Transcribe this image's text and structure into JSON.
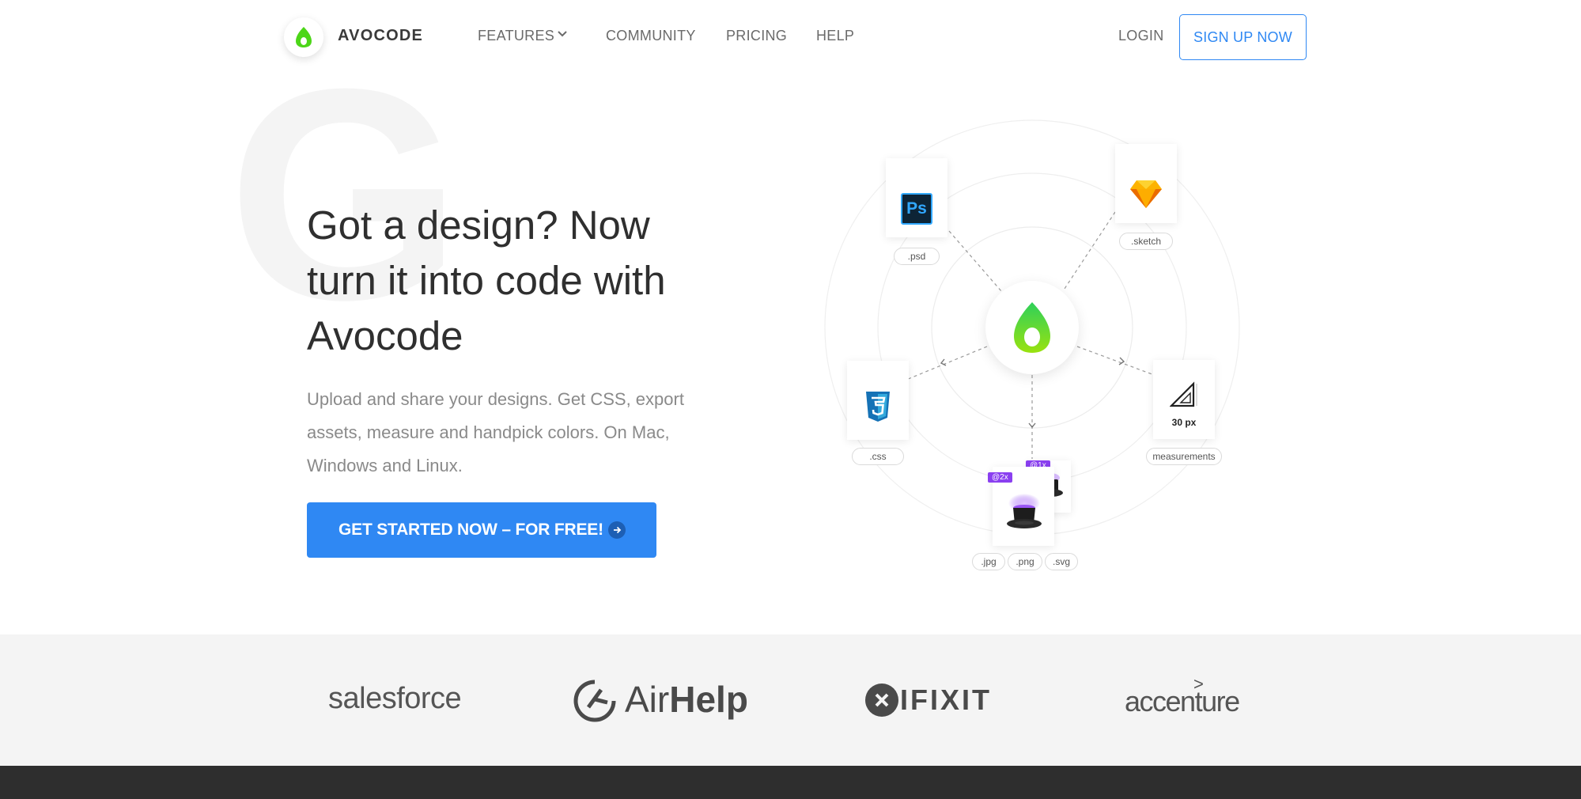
{
  "brand": {
    "name": "AVOCODE",
    "accent": "#2f88f3",
    "logo_green": "#4cd618"
  },
  "nav": {
    "features": "FEATURES",
    "community": "COMMUNITY",
    "pricing": "PRICING",
    "help": "HELP",
    "login": "LOGIN",
    "signup": "SIGN UP NOW"
  },
  "hero": {
    "background_letter": "G",
    "title": "Got a design? Now turn it into code with Avocode",
    "subtitle": "Upload and share your designs. Get CSS, export assets, measure and handpick colors. On Mac, Windows and Linux.",
    "cta": "GET STARTED NOW – FOR FREE!"
  },
  "diagram": {
    "psd_icon": "Ps",
    "psd_label": ".psd",
    "sketch_label": ".sketch",
    "css_label": ".css",
    "measure_value": "30 px",
    "measure_label": "measurements",
    "tag_2x": "@2x",
    "tag_1x": "@1x",
    "jpg_label": ".jpg",
    "png_label": ".png",
    "svg_label": ".svg"
  },
  "logos": {
    "salesforce": "salesforce",
    "airhelp_air": "Air",
    "airhelp_help": "Help",
    "ifixit": "IFIXIT",
    "accenture": "accenture",
    "accenture_mark": ">"
  }
}
